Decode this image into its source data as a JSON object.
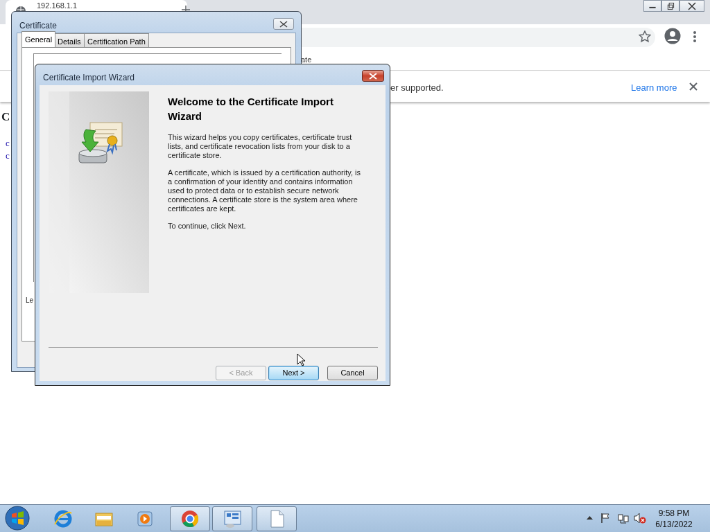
{
  "browser": {
    "tab_title": "192.168.1.1",
    "bookmark_fragment": "ate",
    "infobar": {
      "text": "er supported.",
      "link": "Learn more"
    },
    "page": {
      "heading": "C",
      "links": [
        "c",
        "c"
      ]
    }
  },
  "certificate_window": {
    "title": "Certificate",
    "tabs": [
      {
        "label": "General",
        "selected": true
      },
      {
        "label": "Details",
        "selected": false
      },
      {
        "label": "Certification Path",
        "selected": false
      }
    ],
    "footer_fragment": "Le"
  },
  "wizard": {
    "title": "Certificate Import Wizard",
    "heading": "Welcome to the Certificate Import Wizard",
    "paragraphs": [
      "This wizard helps you copy certificates, certificate trust lists, and certificate revocation lists from your disk to a certificate store.",
      "A certificate, which is issued by a certification authority, is a confirmation of your identity and contains information used to protect data or to establish secure network connections. A certificate store is the system area where certificates are kept.",
      "To continue, click Next."
    ],
    "buttons": [
      {
        "label": "< Back",
        "disabled": true,
        "default": false
      },
      {
        "label": "Next >",
        "disabled": false,
        "default": true
      },
      {
        "label": "Cancel",
        "disabled": false,
        "default": false
      }
    ]
  },
  "taskbar": {
    "apps": [
      {
        "kind": "ie",
        "active": false
      },
      {
        "kind": "explorer",
        "active": false
      },
      {
        "kind": "media",
        "active": false
      },
      {
        "kind": "chrome",
        "active": true
      },
      {
        "kind": "control",
        "active": true
      },
      {
        "kind": "document",
        "active": true
      }
    ],
    "clock": {
      "time": "9:58 PM",
      "date": "6/13/2022"
    }
  }
}
